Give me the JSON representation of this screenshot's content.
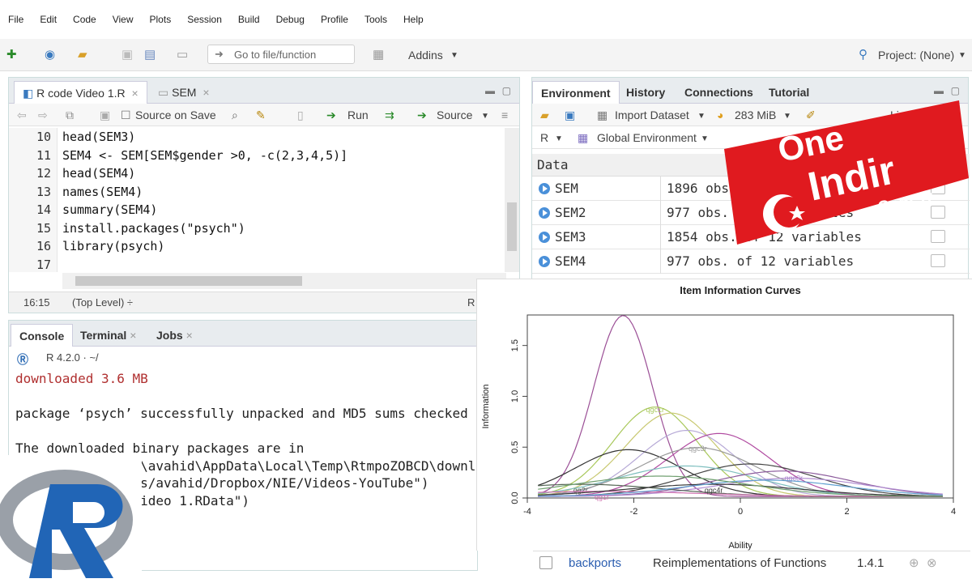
{
  "menu": [
    "File",
    "Edit",
    "Code",
    "View",
    "Plots",
    "Session",
    "Build",
    "Debug",
    "Profile",
    "Tools",
    "Help"
  ],
  "toolbar": {
    "goto_placeholder": "Go to file/function",
    "addins": "Addins",
    "project": "Project: (None)"
  },
  "editor": {
    "tabs": [
      "R code Video 1.R",
      "SEM"
    ],
    "source_on_save": "Source on Save",
    "run": "Run",
    "source": "Source",
    "lines": [
      {
        "n": "10",
        "code": "head(SEM3)"
      },
      {
        "n": "11",
        "code": "SEM4 <- SEM[SEM$gender >0, -c(2,3,4,5)]"
      },
      {
        "n": "12",
        "code": "head(SEM4)"
      },
      {
        "n": "13",
        "code": "names(SEM4)"
      },
      {
        "n": "14",
        "code": "summary(SEM4)"
      },
      {
        "n": "15",
        "code": "install.packages(\"psych\")"
      },
      {
        "n": "16",
        "code": "library(psych)"
      },
      {
        "n": "17",
        "code": ""
      }
    ],
    "status_pos": "16:15",
    "status_level": "(Top Level) ÷",
    "status_lang": "R"
  },
  "console": {
    "tabs": [
      "Console",
      "Terminal",
      "Jobs"
    ],
    "version": "R 4.2.0 · ~/",
    "lines": [
      "downloaded 3.6 MB",
      "",
      "package ‘psych’ successfully unpacked and MD5 sums checked",
      "",
      "The downloaded binary packages are in",
      "        C:\\Users\\avahid\\AppData\\Local\\Temp\\RtmpoZOBCD\\downloaded_packages",
      "> setwd(\"C:/Users/avahid/Dropbox/NIE/Videos-YouTube\")",
      "> load(\"R code Video 1.RData\")"
    ]
  },
  "env": {
    "tabs": [
      "Environment",
      "History",
      "Connections",
      "Tutorial"
    ],
    "import": "Import Dataset",
    "memory": "283 MiB",
    "list": "List",
    "lang": "R",
    "scope": "Global Environment",
    "section": "Data",
    "rows": [
      {
        "name": "SEM",
        "desc": "1896 obs. of 32 variables"
      },
      {
        "name": "SEM2",
        "desc": "977 obs. of 32 variables"
      },
      {
        "name": "SEM3",
        "desc": "1854 obs. of 12 variables"
      },
      {
        "name": "SEM4",
        "desc": "977 obs. of 12 variables"
      }
    ]
  },
  "chart_data": {
    "type": "line",
    "title": "Item Information Curves",
    "xlabel": "Ability",
    "ylabel": "Information",
    "xlim": [
      -4,
      4
    ],
    "ylim": [
      0,
      1.8
    ],
    "xticks": [
      -4,
      -2,
      0,
      2,
      4
    ],
    "yticks": [
      0.0,
      0.5,
      1.0,
      1.5
    ],
    "series": [
      {
        "name": "",
        "mu": -2.2,
        "height": 1.78,
        "width": 0.55,
        "color": "#9b4f96"
      },
      {
        "name": "qgc1r",
        "mu": -1.6,
        "height": 0.88,
        "width": 0.8,
        "color": "#a8c85a"
      },
      {
        "name": "",
        "mu": -1.3,
        "height": 0.82,
        "width": 0.85,
        "color": "#c8c870"
      },
      {
        "name": "",
        "mu": -1.0,
        "height": 0.65,
        "width": 0.9,
        "color": "#b6a9d6"
      },
      {
        "name": "",
        "mu": -0.4,
        "height": 0.62,
        "width": 0.95,
        "color": "#b04aa0"
      },
      {
        "name": "",
        "mu": -2.1,
        "height": 0.46,
        "width": 1.0,
        "color": "#333333"
      },
      {
        "name": "qgc3r",
        "mu": -0.8,
        "height": 0.48,
        "width": 1.1,
        "color": "#999999"
      },
      {
        "name": "",
        "mu": 0.2,
        "height": 0.32,
        "width": 1.2,
        "color": "#444444"
      },
      {
        "name": "",
        "mu": -1.0,
        "height": 0.3,
        "width": 1.3,
        "color": "#7fbfbf"
      },
      {
        "name": "",
        "mu": 0.8,
        "height": 0.25,
        "width": 1.3,
        "color": "#8b5a9b"
      },
      {
        "name": "qgc3r",
        "mu": 1.0,
        "height": 0.18,
        "width": 1.4,
        "color": "#b08cd0"
      },
      {
        "name": "qg2r",
        "mu": -3.0,
        "height": 0.12,
        "width": 1.6,
        "color": "#556655"
      },
      {
        "name": "qg1r",
        "mu": -2.6,
        "height": 0.05,
        "width": 1.8,
        "color": "#d070b0"
      },
      {
        "name": "qgc4r",
        "mu": -0.5,
        "height": 0.12,
        "width": 1.6,
        "color": "#3a3a3a"
      },
      {
        "name": "",
        "mu": 0.5,
        "height": 0.16,
        "width": 1.5,
        "color": "#60a0d0"
      },
      {
        "name": "",
        "mu": -1.5,
        "height": 0.2,
        "width": 1.6,
        "color": "#70a070"
      }
    ]
  },
  "package_row": {
    "name": "backports",
    "desc": "Reimplementations of Functions",
    "version": "1.4.1"
  },
  "watermark": {
    "line1": "One",
    "line2": "Indir",
    "line3": ".Com.Tr"
  },
  "colors": {
    "accent": "#4a90d9",
    "watermark_red": "#e01a1f"
  }
}
